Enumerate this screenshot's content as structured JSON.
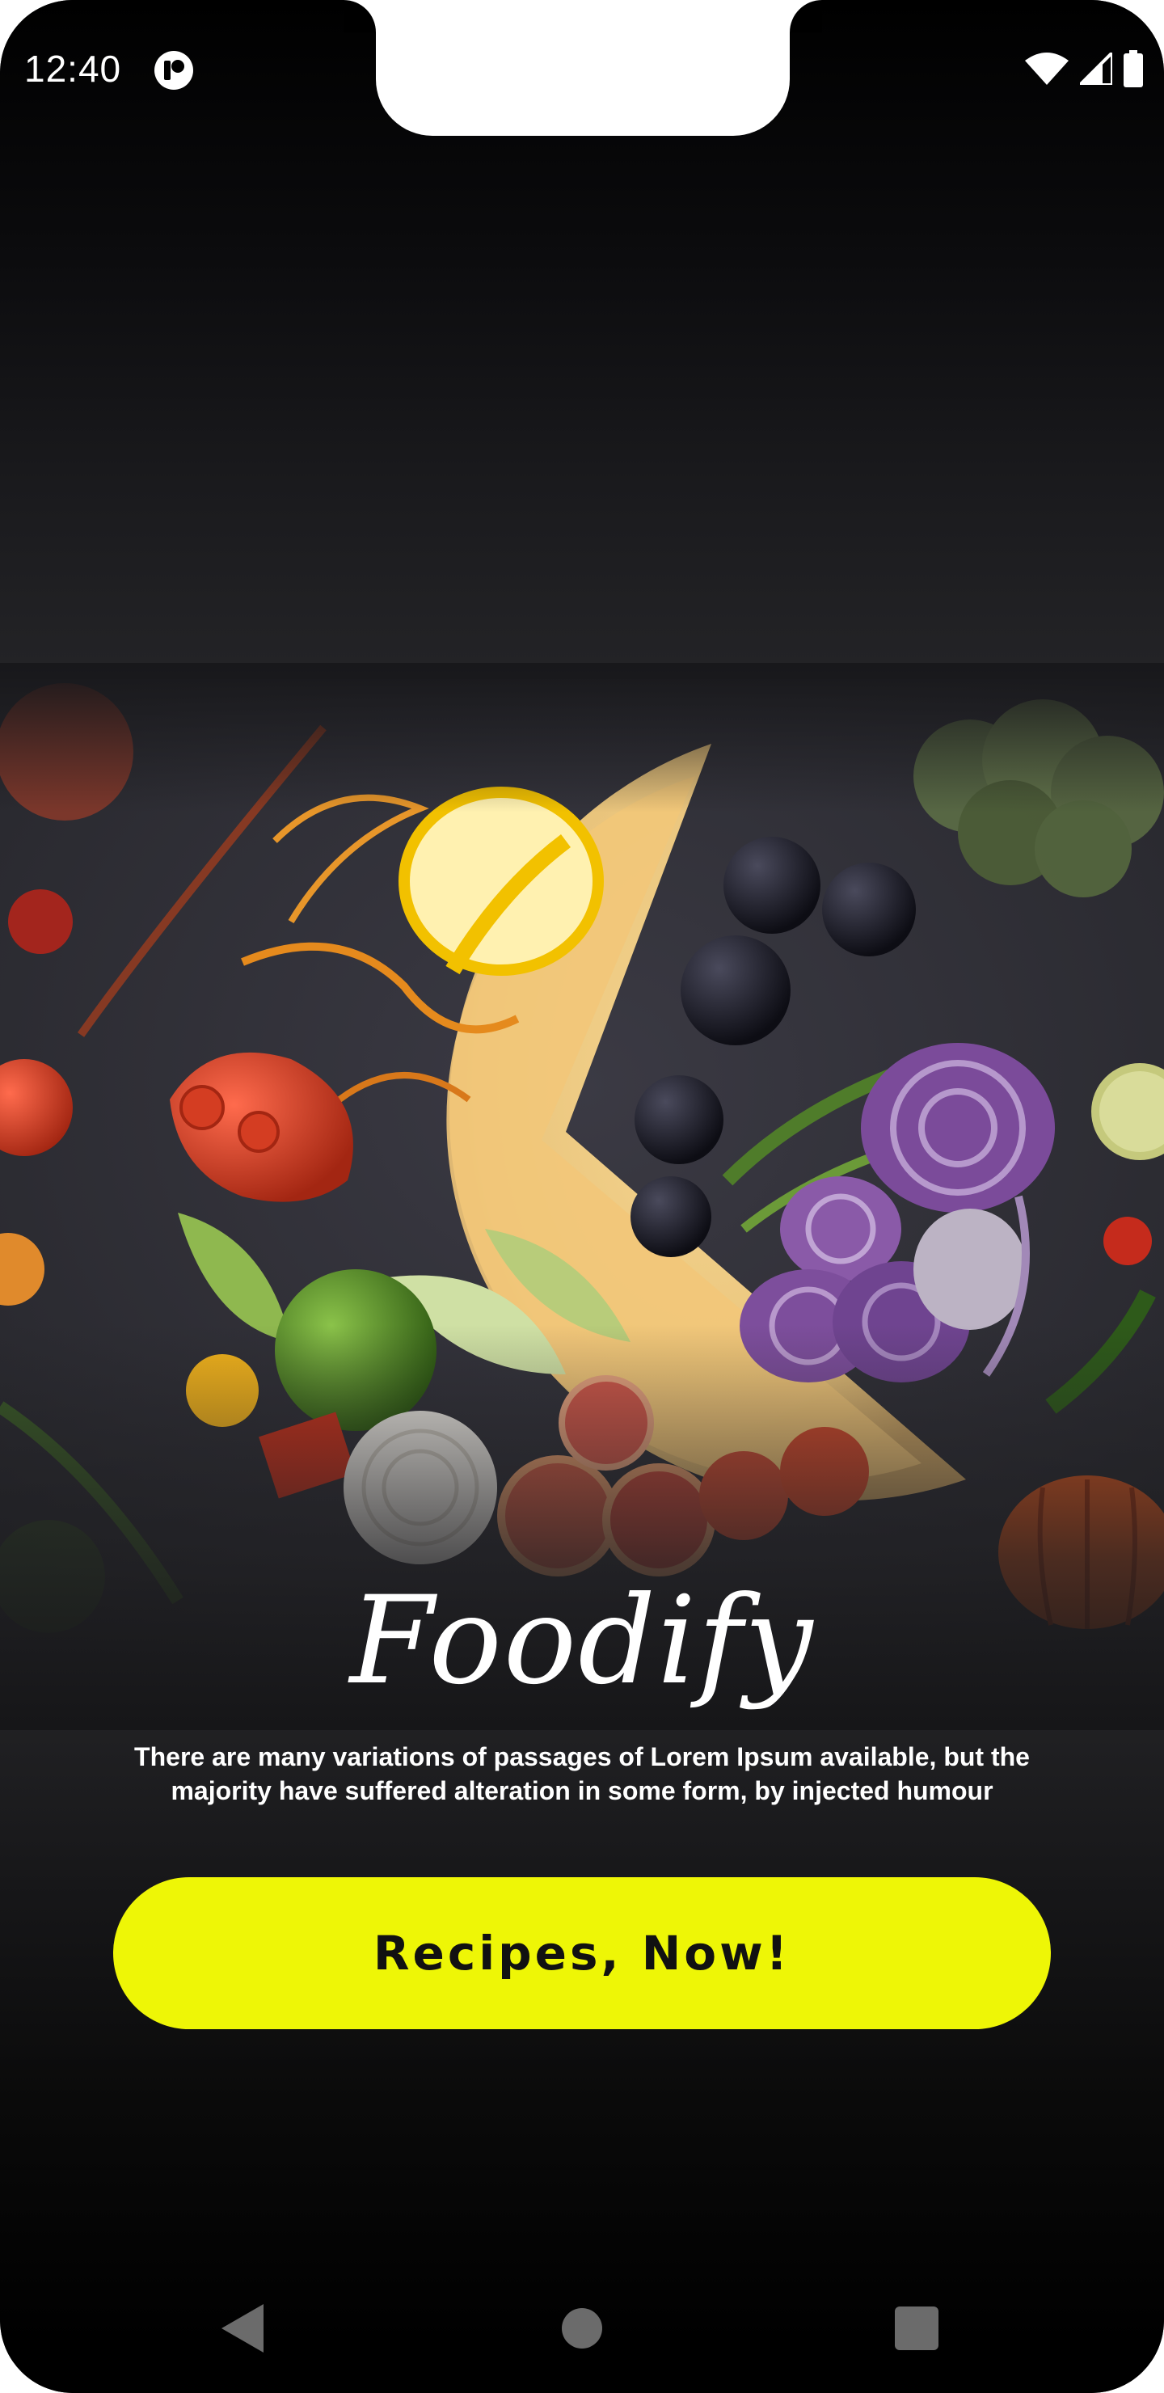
{
  "status_bar": {
    "time": "12:40",
    "icons": [
      "app-notification-icon",
      "wifi-icon",
      "cellular-signal-icon",
      "battery-icon"
    ]
  },
  "hero": {
    "image_name": "food-plate-illustration"
  },
  "onboarding": {
    "title": "Foodify",
    "description": "There are many variations of passages of Lorem Ipsum available, but the majority have suffered alteration in some form, by injected humour",
    "cta_label": "Recipes, Now!"
  },
  "navigation": {
    "buttons": [
      "back-icon",
      "home-icon",
      "recents-icon"
    ]
  },
  "colors": {
    "accent": "#eef606",
    "background": "#000000",
    "text": "#ffffff"
  }
}
